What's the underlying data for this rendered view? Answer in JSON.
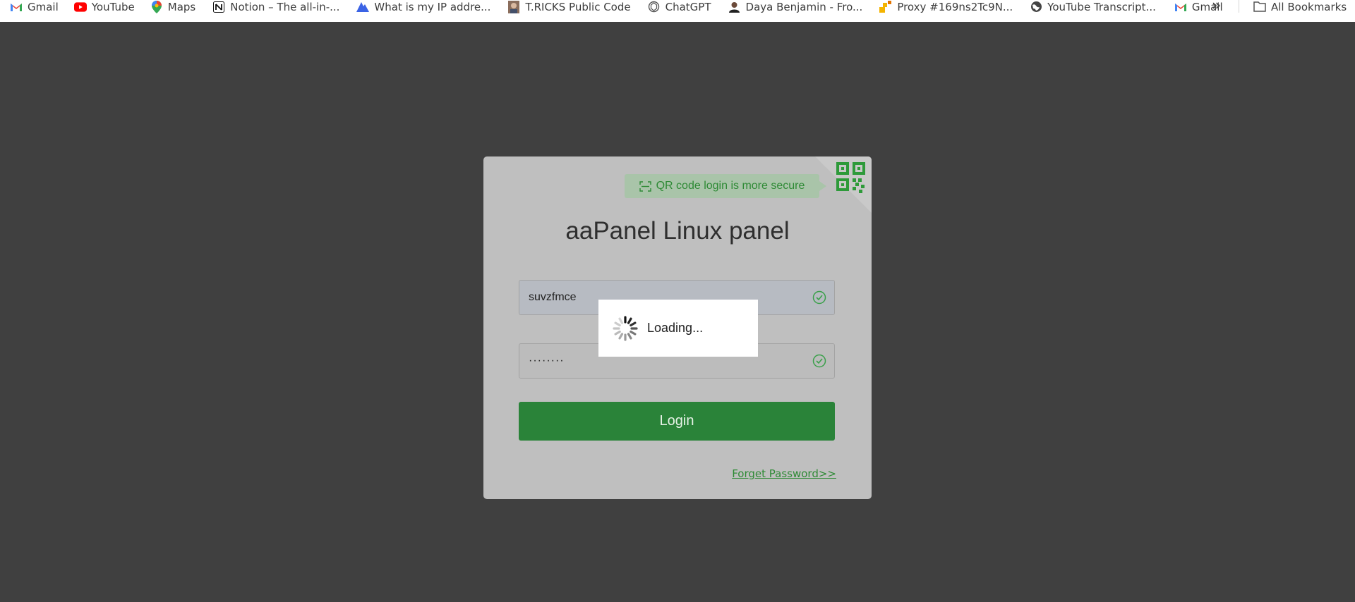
{
  "bookmarks": [
    {
      "label": "Gmail",
      "icon": "gmail-icon"
    },
    {
      "label": "YouTube",
      "icon": "youtube-icon"
    },
    {
      "label": "Maps",
      "icon": "maps-icon"
    },
    {
      "label": "Notion – The all-in-...",
      "icon": "notion-icon"
    },
    {
      "label": "What is my IP addre...",
      "icon": "ip-icon"
    },
    {
      "label": "T.RICKS Public Code",
      "icon": "avatar-icon"
    },
    {
      "label": "ChatGPT",
      "icon": "chatgpt-icon"
    },
    {
      "label": "Daya Benjamin - Fro...",
      "icon": "avatar-icon"
    },
    {
      "label": "Proxy #169ns2Tc9N...",
      "icon": "proxy-icon"
    },
    {
      "label": "YouTube Transcript...",
      "icon": "globe-icon"
    },
    {
      "label": "Gmail",
      "icon": "gmail-icon"
    }
  ],
  "all_bookmarks_label": "All Bookmarks",
  "login": {
    "qr_tip": "QR code login is more secure",
    "title": "aaPanel Linux panel",
    "username_value": "suvzfmce",
    "password_value": "········",
    "login_label": "Login",
    "forget_label": "Forget Password>>"
  },
  "loading": {
    "text": "Loading..."
  },
  "colors": {
    "accent": "#2a8339",
    "overlay": "#404040",
    "card": "#bfbfbf"
  }
}
